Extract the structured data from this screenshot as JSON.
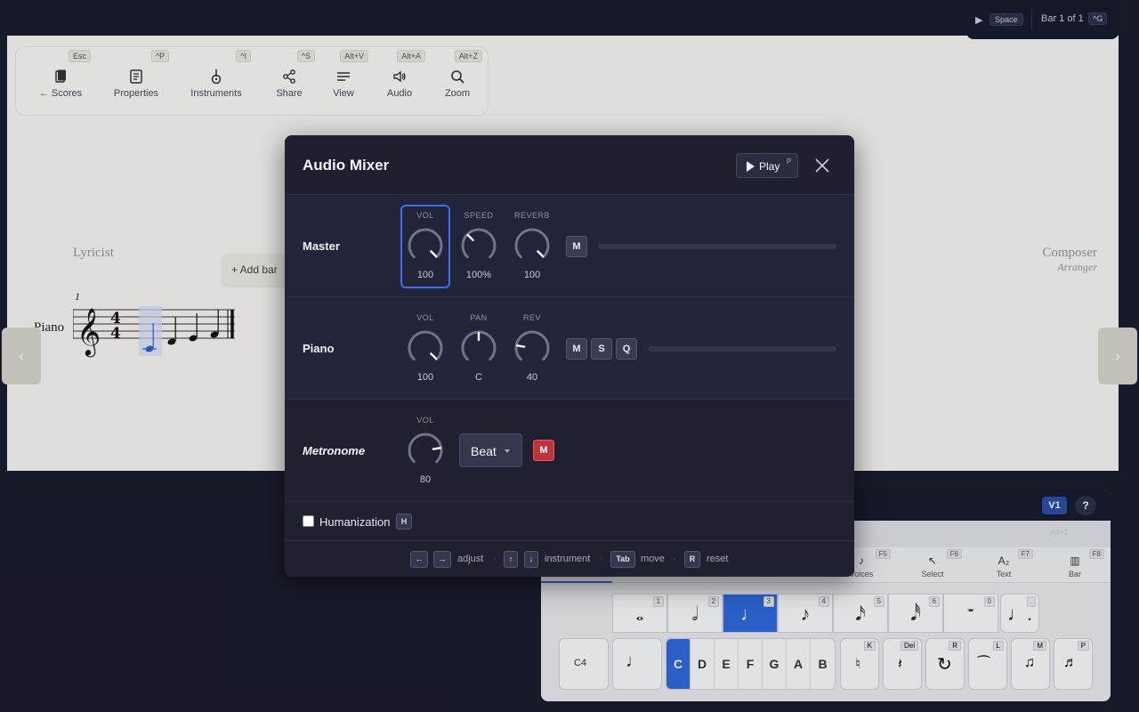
{
  "toolbar": {
    "items": [
      {
        "label": "← Scores",
        "key": "Esc",
        "icon": "scores-icon"
      },
      {
        "label": "Properties",
        "key": "^P",
        "icon": "properties-icon"
      },
      {
        "label": "Instruments",
        "key": "^I",
        "icon": "instruments-icon"
      },
      {
        "label": "Share",
        "key": "^S",
        "icon": "share-icon"
      },
      {
        "label": "View",
        "key": "Alt+V",
        "icon": "view-icon"
      },
      {
        "label": "Audio",
        "key": "Alt+A",
        "icon": "audio-icon"
      },
      {
        "label": "Zoom",
        "key": "Alt+Z",
        "icon": "zoom-icon"
      }
    ]
  },
  "score": {
    "lyricist": "Lyricist",
    "composer": "Composer",
    "arranger": "Arranger",
    "add_bar": "+ Add bar",
    "bar_number": "1",
    "instrument": "Piano"
  },
  "transport": {
    "play_key": "Space",
    "bar_status": "Bar 1 of 1",
    "goto_key": "^G"
  },
  "mixer": {
    "title": "Audio Mixer",
    "play_label": "Play",
    "play_key": "P",
    "rows": {
      "master": {
        "label": "Master",
        "knobs": [
          {
            "label": "VOL",
            "value": "100",
            "level": 1.0
          },
          {
            "label": "SPEED",
            "value": "100%",
            "level": 0.33
          },
          {
            "label": "REVERB",
            "value": "100",
            "level": 1.0
          }
        ],
        "mute": "M"
      },
      "piano": {
        "label": "Piano",
        "knobs": [
          {
            "label": "VOL",
            "value": "100",
            "level": 1.0
          },
          {
            "label": "PAN",
            "value": "C",
            "level": 0.5
          },
          {
            "label": "REV",
            "value": "40",
            "level": 0.2
          }
        ],
        "mute": "M",
        "solo": "S",
        "q": "Q"
      },
      "metronome": {
        "label": "Metronome",
        "knobs": [
          {
            "label": "VOL",
            "value": "80",
            "level": 0.8
          }
        ],
        "mode": "Beat",
        "mute": "M"
      }
    },
    "humanization": {
      "label": "Humanization",
      "key": "H"
    },
    "footer": {
      "left_key": "←",
      "right_key": "→",
      "adjust": "adjust",
      "up_key": "↑",
      "down_key": "↓",
      "instrument": "instrument",
      "tab_key": "Tab",
      "move": "move",
      "reset_key": "R",
      "reset": "reset"
    }
  },
  "palette": {
    "voice": "V1",
    "help": "?",
    "alt_hint": "Alt+1",
    "tabs": [
      {
        "label": "Voices",
        "key": "F5",
        "icon": "♪"
      },
      {
        "label": "Select",
        "key": "F6",
        "icon": "↖"
      },
      {
        "label": "Text",
        "key": "F7",
        "icon": "A₂"
      },
      {
        "label": "Bar",
        "key": "F8",
        "icon": "▥"
      }
    ],
    "durations": [
      {
        "key": "1",
        "icon": "𝅝"
      },
      {
        "key": "2",
        "icon": "𝅗𝅥"
      },
      {
        "key": "3",
        "icon": "♩"
      },
      {
        "key": "4",
        "icon": "♪"
      },
      {
        "key": "5",
        "icon": "𝅘𝅥𝅯"
      },
      {
        "key": "6",
        "icon": "𝅘𝅥𝅰"
      },
      {
        "key": "0",
        "icon": "𝄻"
      },
      {
        "key": ".",
        "icon": "♩."
      }
    ],
    "octave": "C4",
    "pitches": [
      "C",
      "D",
      "E",
      "F",
      "G",
      "A",
      "B"
    ],
    "tool_keys": [
      "K",
      "Del",
      "R",
      "L",
      "M",
      "P"
    ]
  }
}
